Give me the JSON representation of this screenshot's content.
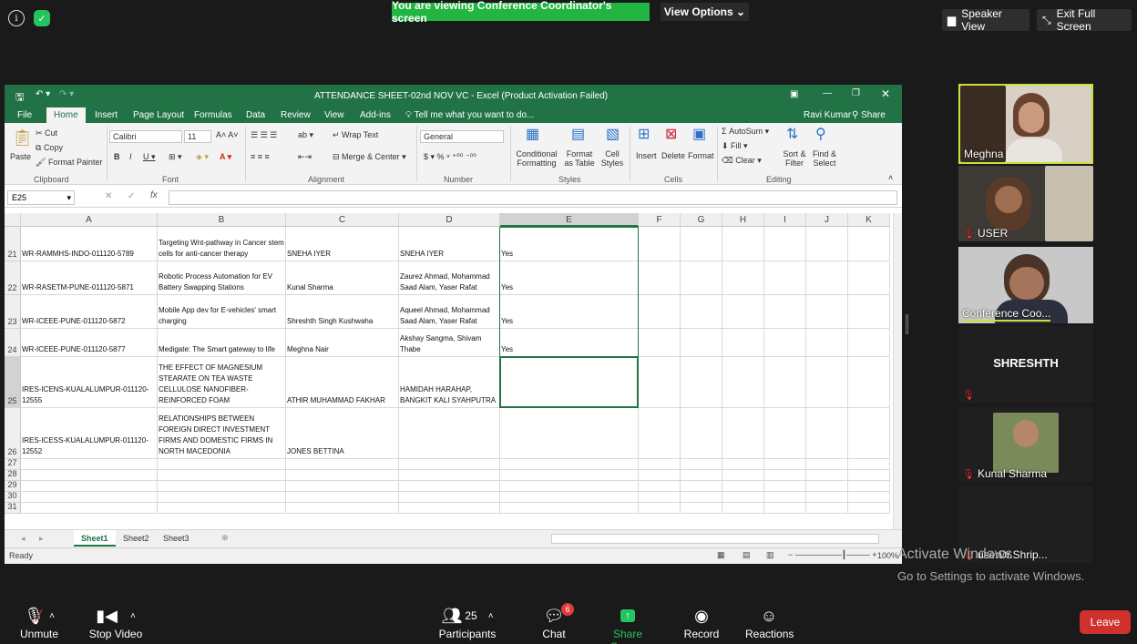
{
  "topbar": {
    "banner": "You are viewing Conference Coordinator's screen",
    "view_options": "View Options",
    "speaker_view": "Speaker View",
    "exit_fullscreen": "Exit Full Screen"
  },
  "excel": {
    "title": "ATTENDANCE SHEET-02nd NOV VC - Excel (Product Activation Failed)",
    "user": "Ravi Kumar",
    "share": "Share",
    "tabs": [
      "File",
      "Home",
      "Insert",
      "Page Layout",
      "Formulas",
      "Data",
      "Review",
      "View",
      "Add-ins"
    ],
    "tell_me": "Tell me what you want to do...",
    "ribbon": {
      "cut": "Cut",
      "copy": "Copy",
      "paste": "Paste",
      "format_painter": "Format Painter",
      "font_name": "Calibri",
      "font_size": "11",
      "wrap_text": "Wrap Text",
      "merge_center": "Merge & Center",
      "number_format": "General",
      "conditional": "Conditional Formatting",
      "format_table": "Format as Table",
      "cell_styles": "Cell Styles",
      "insert": "Insert",
      "delete": "Delete",
      "format": "Format",
      "autosum": "AutoSum",
      "fill": "Fill",
      "clear": "Clear",
      "sort_filter": "Sort & Filter",
      "find_select": "Find & Select",
      "groups": [
        "Clipboard",
        "Font",
        "Alignment",
        "Number",
        "Styles",
        "Cells",
        "Editing"
      ]
    },
    "namebox": "E25",
    "columns": [
      "A",
      "B",
      "C",
      "D",
      "E",
      "F",
      "G",
      "H",
      "I",
      "J",
      "K"
    ],
    "rows": [
      {
        "num": "21",
        "a": "WR-RAMMHS-INDO-011120-5789",
        "b": "Targeting Wnt-pathway in Cancer stem cells for anti-cancer therapy",
        "c": "SNEHA IYER",
        "d": "SNEHA IYER",
        "e": "Yes"
      },
      {
        "num": "22",
        "a": "WR-RASETM-PUNE-011120-5871",
        "b": "Robotic Process Automation for EV Battery Swapping Stations",
        "c": "Kunal Sharma",
        "d": "Zaurez Ahmad, Mohammad Saad Alam, Yaser Rafat",
        "e": "Yes"
      },
      {
        "num": "23",
        "a": "WR-ICEEE-PUNE-011120-5872",
        "b": "Mobile App dev for E-vehicles' smart charging",
        "c": "Shreshth Singh Kushwaha",
        "d": "Aqueel Ahmad, Mohammad Saad Alam, Yaser Rafat",
        "e": "Yes"
      },
      {
        "num": "24",
        "a": "WR-ICEEE-PUNE-011120-5877",
        "b": "Medigate: The Smart gateway to life",
        "c": "Meghna Nair",
        "d": "Akshay Sangma, Shivam Thabe",
        "e": "Yes"
      },
      {
        "num": "25",
        "a": "IRES-ICENS-KUALALUMPUR-011120-12555",
        "b": "THE EFFECT OF MAGNESIUM STEARATE ON TEA WASTE CELLULOSE NANOFIBER-REINFORCED FOAM",
        "c": "ATHIR MUHAMMAD FAKHAR",
        "d": "HAMIDAH HARAHAP, BANGKIT KALI SYAHPUTRA",
        "e": ""
      },
      {
        "num": "26",
        "a": "IRES-ICESS-KUALALUMPUR-011120-12552",
        "b": "RELATIONSHIPS BETWEEN FOREIGN DIRECT INVESTMENT FIRMS AND DOMESTIC FIRMS IN NORTH MACEDONIA",
        "c": "JONES BETTINA",
        "d": "",
        "e": ""
      },
      {
        "num": "27",
        "a": "",
        "b": "",
        "c": "",
        "d": "",
        "e": ""
      },
      {
        "num": "28",
        "a": "",
        "b": "",
        "c": "",
        "d": "",
        "e": ""
      },
      {
        "num": "29",
        "a": "",
        "b": "",
        "c": "",
        "d": "",
        "e": ""
      },
      {
        "num": "30",
        "a": "",
        "b": "",
        "c": "",
        "d": "",
        "e": ""
      },
      {
        "num": "31",
        "a": "",
        "b": "",
        "c": "",
        "d": "",
        "e": ""
      }
    ],
    "sheets": [
      "Sheet1",
      "Sheet2",
      "Sheet3"
    ],
    "status": "Ready",
    "zoom": "100%"
  },
  "participants": {
    "meghna": "Meghna",
    "user": "USER",
    "coordinator": "Conference Coo...",
    "shreshth": "SHRESHTH",
    "kunal": "Kunal Sharma",
    "dr": "userDr.Shrip..."
  },
  "watermark": {
    "line1": "Activate Windows",
    "line2": "Go to Settings to activate Windows."
  },
  "toolbar": {
    "unmute": "Unmute",
    "stop_video": "Stop Video",
    "participants": "Participants",
    "participant_count": "25",
    "chat": "Chat",
    "chat_badge": "6",
    "share_screen": "Share Screen",
    "record": "Record",
    "reactions": "Reactions",
    "leave": "Leave"
  }
}
